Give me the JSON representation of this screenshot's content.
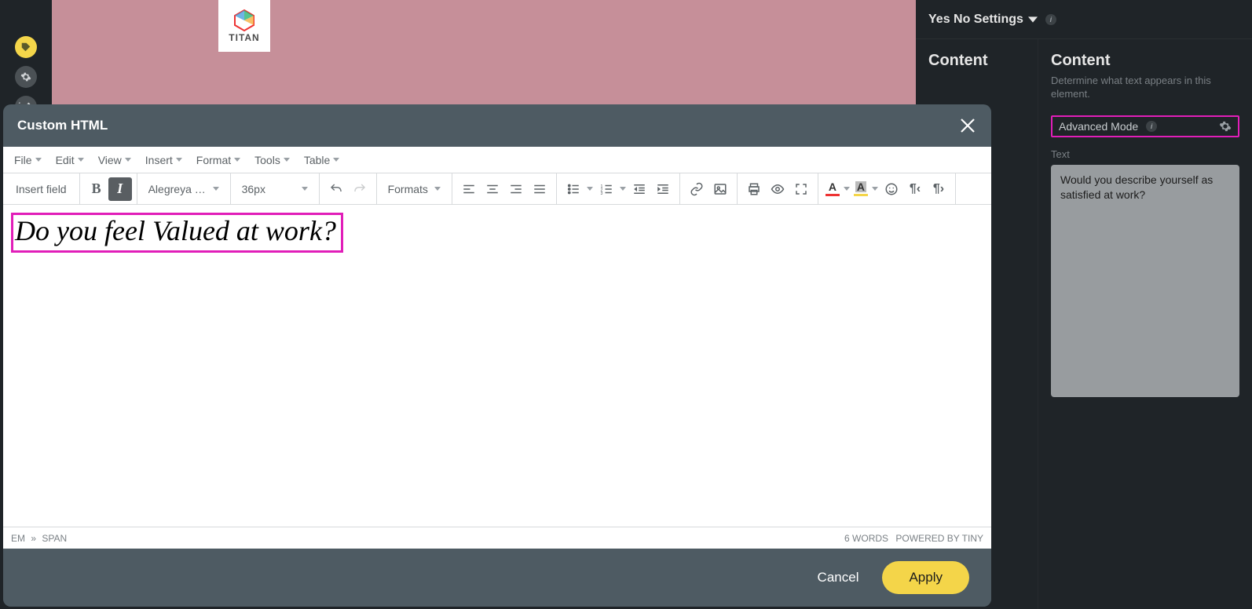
{
  "background": {
    "logo_text": "TITAN"
  },
  "right_panel": {
    "header": "Yes No Settings",
    "col_a_title": "Content",
    "col_b_title": "Content",
    "col_b_subtext": "Determine what text appears in this element.",
    "advanced_mode_label": "Advanced Mode",
    "text_label": "Text",
    "text_value": "Would you describe yourself as satisfied at work?"
  },
  "modal": {
    "title": "Custom HTML",
    "menu": {
      "file": "File",
      "edit": "Edit",
      "view": "View",
      "insert": "Insert",
      "format": "Format",
      "tools": "Tools",
      "table": "Table"
    },
    "toolbar": {
      "insert_field": "Insert field",
      "font_family": "Alegreya S...",
      "font_size": "36px",
      "formats": "Formats"
    },
    "content": "Do you feel Valued at work?",
    "status": {
      "path_em": "EM",
      "path_sep": "»",
      "path_span": "SPAN",
      "words_label": "6 WORDS",
      "powered": "POWERED BY TINY"
    },
    "footer": {
      "cancel": "Cancel",
      "apply": "Apply"
    }
  }
}
